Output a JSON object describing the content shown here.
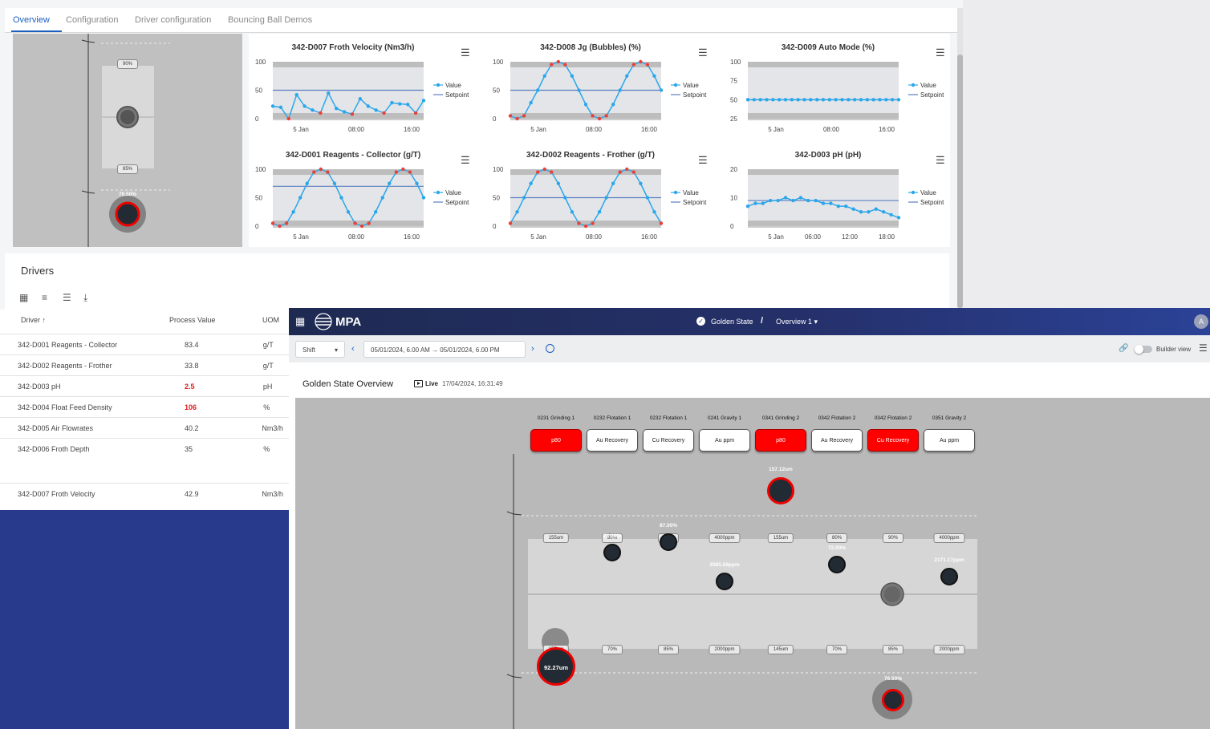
{
  "tabs": [
    {
      "label": "Overview",
      "active": true
    },
    {
      "label": "Configuration",
      "active": false
    },
    {
      "label": "Driver configuration",
      "active": false
    },
    {
      "label": "Bouncing Ball Demos",
      "active": false
    }
  ],
  "left_viz": {
    "top_pill": "90%",
    "bottom_pill": "85%",
    "ball_value": "76.50%"
  },
  "charts": [
    {
      "title": "342-D007 Froth Velocity (Nm3/h)",
      "y_ticks": [
        "100",
        "50",
        "0"
      ],
      "x_ticks": [
        "5 Jan",
        "08:00",
        "16:00"
      ],
      "legend": [
        "Value",
        "Setpoint"
      ],
      "setpoint": 50,
      "ymin": 0,
      "ymax": 100,
      "values": [
        22,
        20,
        0,
        42,
        22,
        15,
        10,
        45,
        18,
        12,
        8,
        35,
        22,
        15,
        10,
        28,
        26,
        25,
        10,
        32
      ]
    },
    {
      "title": "342-D008 Jg (Bubbles) (%)",
      "y_ticks": [
        "100",
        "50",
        "0"
      ],
      "x_ticks": [
        "5 Jan",
        "08:00",
        "16:00"
      ],
      "legend": [
        "Value",
        "Setpoint"
      ],
      "setpoint": 50,
      "ymin": 0,
      "ymax": 100,
      "values": [
        5,
        0,
        5,
        28,
        50,
        75,
        95,
        100,
        95,
        75,
        50,
        25,
        5,
        0,
        5,
        25,
        50,
        75,
        95,
        100,
        95,
        75,
        50
      ]
    },
    {
      "title": "342-D009 Auto Mode (%)",
      "y_ticks": [
        "100",
        "75",
        "50",
        "25"
      ],
      "x_ticks": [
        "5 Jan",
        "08:00",
        "16:00"
      ],
      "legend": [
        "Value",
        "Setpoint"
      ],
      "setpoint": 50,
      "ymin": 25,
      "ymax": 100,
      "values": [
        50,
        50,
        50,
        50,
        50,
        50,
        50,
        50,
        50,
        50,
        50,
        50,
        50,
        50,
        50,
        50,
        50,
        50,
        50,
        50,
        50,
        50,
        50,
        50,
        50
      ]
    },
    {
      "title": "342-D001 Reagents - Collector (g/T)",
      "y_ticks": [
        "100",
        "50",
        "0"
      ],
      "x_ticks": [
        "5 Jan",
        "08:00",
        "16:00"
      ],
      "legend": [
        "Value",
        "Setpoint"
      ],
      "setpoint": 70,
      "ymin": 0,
      "ymax": 100,
      "values": [
        5,
        0,
        5,
        25,
        50,
        75,
        95,
        100,
        95,
        75,
        50,
        25,
        5,
        0,
        5,
        25,
        50,
        75,
        95,
        100,
        95,
        75,
        50
      ]
    },
    {
      "title": "342-D002 Reagents - Frother (g/T)",
      "y_ticks": [
        "100",
        "50",
        "0"
      ],
      "x_ticks": [
        "5 Jan",
        "08:00",
        "16:00"
      ],
      "legend": [
        "Value",
        "Setpoint"
      ],
      "setpoint": 50,
      "ymin": 0,
      "ymax": 100,
      "values": [
        5,
        25,
        50,
        75,
        95,
        100,
        95,
        75,
        50,
        25,
        5,
        0,
        5,
        25,
        50,
        75,
        95,
        100,
        95,
        75,
        50,
        25,
        5
      ]
    },
    {
      "title": "342-D003 pH (pH)",
      "y_ticks": [
        "20",
        "10",
        "0"
      ],
      "x_ticks": [
        "5 Jan",
        "06:00",
        "12:00",
        "18:00"
      ],
      "legend": [
        "Value",
        "Setpoint"
      ],
      "setpoint": 9,
      "ymin": 0,
      "ymax": 20,
      "values": [
        7,
        8,
        8,
        9,
        9,
        10,
        9,
        10,
        9,
        9,
        8,
        8,
        7,
        7,
        6,
        5,
        5,
        6,
        5,
        4,
        3
      ]
    }
  ],
  "drivers": {
    "title": "Drivers",
    "toolbar_icons": [
      "columns-icon",
      "filter-icon",
      "density-icon",
      "export-icon"
    ],
    "columns": [
      "Driver",
      "Process Value",
      "UOM"
    ],
    "sort_indicator": "↑",
    "rows": [
      {
        "driver": "342-D001 Reagents - Collector",
        "value": "83.4",
        "uom": "g/T",
        "alert": false
      },
      {
        "driver": "342-D002 Reagents - Frother",
        "value": "33.8",
        "uom": "g/T",
        "alert": false
      },
      {
        "driver": "342-D003 pH",
        "value": "2.5",
        "uom": "pH",
        "alert": true
      },
      {
        "driver": "342-D004 Float Feed Density",
        "value": "106",
        "uom": "%",
        "alert": true
      },
      {
        "driver": "342-D005 Air Flowrates",
        "value": "40.2",
        "uom": "Nm3/h",
        "alert": false
      },
      {
        "driver": "342-D006 Froth Depth",
        "value": "35",
        "uom": "%",
        "alert": false
      },
      {
        "driver": "342-D007 Froth Velocity",
        "value": "42.9",
        "uom": "Nm3/h",
        "alert": false
      }
    ]
  },
  "mpa": {
    "brand": "MPA",
    "site": "Golden State",
    "separator": "/",
    "page": "Overview 1",
    "avatar": "A",
    "shift_label": "Shift",
    "date_range": "05/01/2024, 6.00 AM  →  05/01/2024, 6.00 PM",
    "builder_view": "Builder view",
    "overview_title": "Golden State Overview",
    "live_label": "Live",
    "live_time": "17/04/2024, 16:31:49",
    "assets": [
      {
        "label": "0231 Grinding 1",
        "kpi": "p80",
        "alert": true,
        "top_pill": "155um",
        "bottom_pill": "155um"
      },
      {
        "label": "0232 Flotation 1",
        "kpi": "Au Recovery",
        "alert": false,
        "top_pill": "80%",
        "bottom_pill": "70%",
        "value": "73.00%"
      },
      {
        "label": "0232 Flotation 1",
        "kpi": "Cu Recovery",
        "alert": false,
        "top_pill": "90%",
        "bottom_pill": "85%",
        "value": "87.00%"
      },
      {
        "label": "0241 Gravity 1",
        "kpi": "Au ppm",
        "alert": false,
        "top_pill": "4000ppm",
        "bottom_pill": "2000ppm",
        "value": "2085.59ppm"
      },
      {
        "label": "0341 Grinding 2",
        "kpi": "p80",
        "alert": true,
        "top_pill": "155um",
        "bottom_pill": "145um",
        "value": "157.12um"
      },
      {
        "label": "0342 Flotation 2",
        "kpi": "Au Recovery",
        "alert": false,
        "top_pill": "80%",
        "bottom_pill": "70%",
        "value": "72.00%"
      },
      {
        "label": "0342 Flotation 2",
        "kpi": "Cu Recovery",
        "alert": true,
        "top_pill": "90%",
        "bottom_pill": "85%",
        "value": "76.50%"
      },
      {
        "label": "0351 Gravity 2",
        "kpi": "Au ppm",
        "alert": false,
        "top_pill": "4000ppm",
        "bottom_pill": "2000ppm",
        "value": "2171.17ppm"
      }
    ],
    "grinding1_value": "92.27um"
  }
}
